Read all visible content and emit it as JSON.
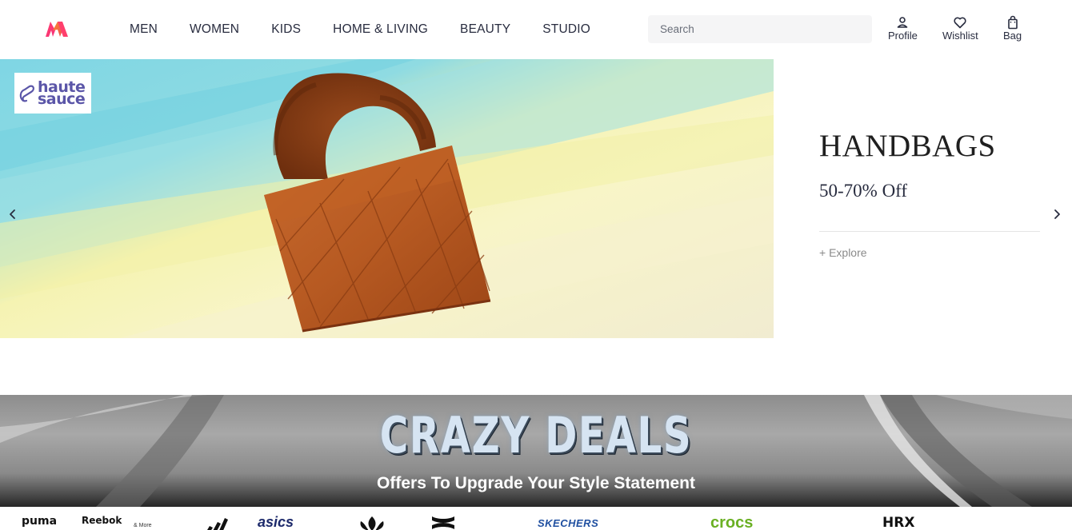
{
  "header": {
    "logo_alt": "Myntra",
    "nav": [
      "MEN",
      "WOMEN",
      "KIDS",
      "HOME & LIVING",
      "BEAUTY",
      "STUDIO"
    ],
    "search": {
      "placeholder": "Search"
    },
    "actions": {
      "profile": "Profile",
      "wishlist": "Wishlist",
      "bag": "Bag"
    }
  },
  "hero": {
    "brand_badge": {
      "line1": "haute",
      "line2": "sauce"
    },
    "title": "HANDBAGS",
    "offer": "50-70% Off",
    "explore": "+ Explore"
  },
  "deals_banner": {
    "title": "CRAZY DEALS",
    "subtitle": "Offers To Upgrade Your Style Statement"
  },
  "brands": {
    "puma": "puma",
    "reebok": "Reebok",
    "more": "& More",
    "asics": "asics",
    "skechers": "SKECHERS",
    "crocs": "crocs",
    "hrx": "HRX"
  },
  "colors": {
    "brand_pink": "#ff3f6c",
    "brand_orange": "#f16565",
    "text": "#282c3f",
    "search_bg": "#f5f5f6",
    "crocs_green": "#6ab023",
    "skechers_blue": "#1f4fa0",
    "asics_navy": "#1d2a6b"
  },
  "icons": [
    "myntra-logo",
    "profile-icon",
    "wishlist-icon",
    "bag-icon",
    "chevron-left-icon",
    "chevron-right-icon"
  ]
}
